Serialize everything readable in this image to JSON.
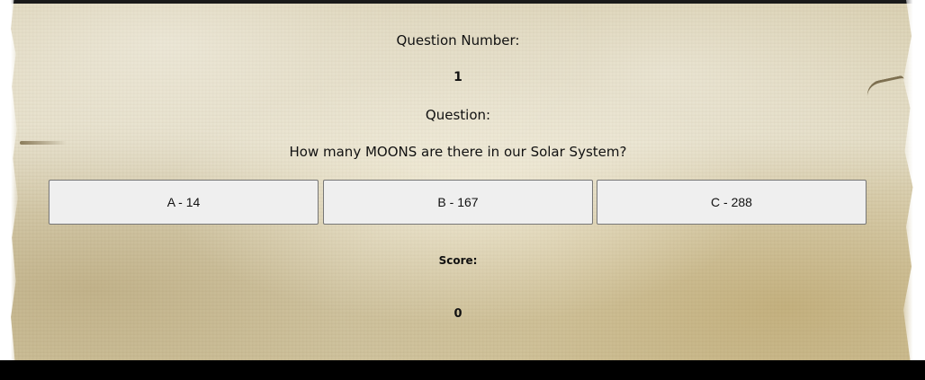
{
  "quiz": {
    "question_number_label": "Question Number:",
    "question_number": "1",
    "question_label": "Question:",
    "question_text": "How many MOONS are there in our Solar System?",
    "answers": [
      {
        "label": "A - 14"
      },
      {
        "label": "B - 167"
      },
      {
        "label": "C - 288"
      }
    ],
    "score_label": "Score:",
    "score_value": "0"
  },
  "colors": {
    "parchment": "#ddd4b8",
    "button_background": "#efefef",
    "button_border": "#767676",
    "text": "#111111",
    "bottom_bar": "#000000"
  }
}
